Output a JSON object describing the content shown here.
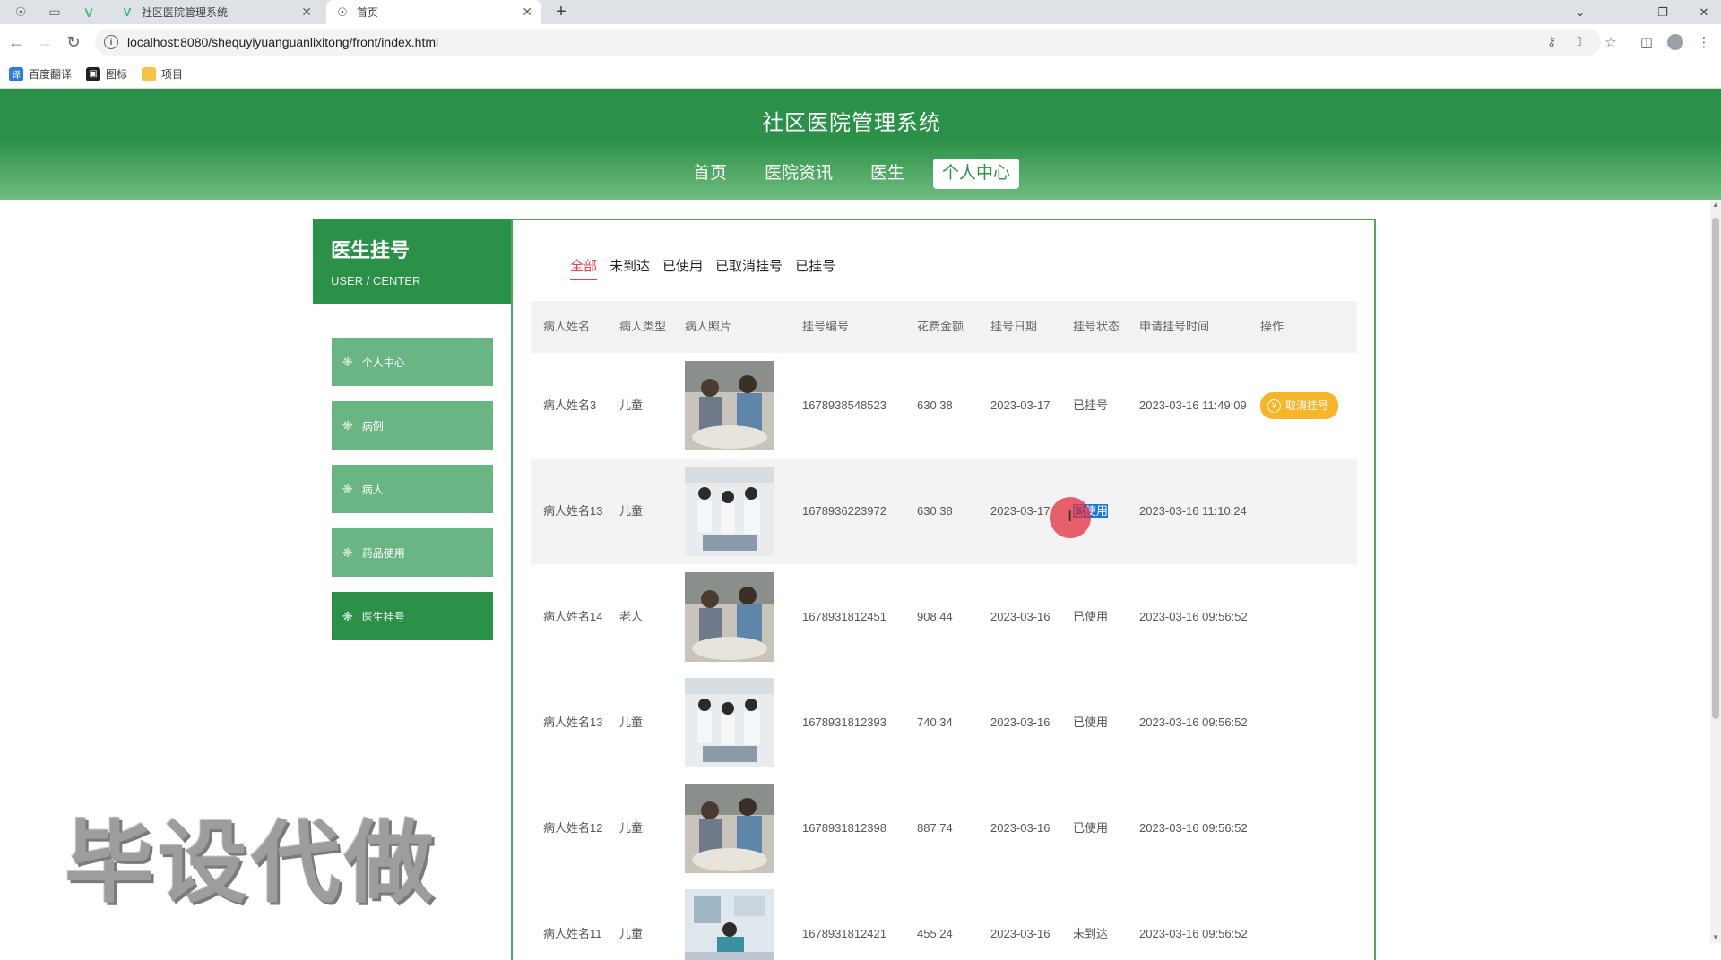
{
  "browser": {
    "tabs": [
      {
        "title": "社区医院管理系统",
        "active": false
      },
      {
        "title": "首页",
        "active": true
      }
    ],
    "url": "localhost:8080/shequyiyuanguanlixitong/front/index.html",
    "bookmarks": [
      {
        "label": "百度翻译",
        "icon": "translate-icon"
      },
      {
        "label": "图标",
        "icon": "image-icon"
      },
      {
        "label": "项目",
        "icon": "folder-icon"
      }
    ]
  },
  "header": {
    "title": "社区医院管理系统",
    "nav": [
      {
        "label": "首页",
        "active": false
      },
      {
        "label": "医院资讯",
        "active": false
      },
      {
        "label": "医生",
        "active": false
      },
      {
        "label": "个人中心",
        "active": true
      }
    ]
  },
  "sidebar": {
    "title": "医生挂号",
    "subtitle": "USER / CENTER",
    "items": [
      {
        "label": "个人中心",
        "active": false
      },
      {
        "label": "病例",
        "active": false
      },
      {
        "label": "病人",
        "active": false
      },
      {
        "label": "药品使用",
        "active": false
      },
      {
        "label": "医生挂号",
        "active": true
      }
    ]
  },
  "filters": [
    {
      "label": "全部",
      "active": true
    },
    {
      "label": "未到达",
      "active": false
    },
    {
      "label": "已使用",
      "active": false
    },
    {
      "label": "已取消挂号",
      "active": false
    },
    {
      "label": "已挂号",
      "active": false
    }
  ],
  "table": {
    "headers": {
      "name": "病人姓名",
      "type": "病人类型",
      "photo": "病人照片",
      "no": "挂号编号",
      "amount": "花费金额",
      "date": "挂号日期",
      "state": "挂号状态",
      "time": "申请挂号时间",
      "op": "操作"
    },
    "rows": [
      {
        "name": "病人姓名3",
        "type": "儿童",
        "photo": "photo-a",
        "no": "1678938548523",
        "amount": "630.38",
        "date": "2023-03-17",
        "state": "已挂号",
        "time": "2023-03-16 11:49:09",
        "action": "取消挂号"
      },
      {
        "name": "病人姓名13",
        "type": "儿童",
        "photo": "photo-b",
        "no": "1678936223972",
        "amount": "630.38",
        "date": "2023-03-17",
        "state": "已使用",
        "time": "2023-03-16 11:10:24",
        "action": ""
      },
      {
        "name": "病人姓名14",
        "type": "老人",
        "photo": "photo-a",
        "no": "1678931812451",
        "amount": "908.44",
        "date": "2023-03-16",
        "state": "已使用",
        "time": "2023-03-16 09:56:52",
        "action": ""
      },
      {
        "name": "病人姓名13",
        "type": "儿童",
        "photo": "photo-b",
        "no": "1678931812393",
        "amount": "740.34",
        "date": "2023-03-16",
        "state": "已使用",
        "time": "2023-03-16 09:56:52",
        "action": ""
      },
      {
        "name": "病人姓名12",
        "type": "儿童",
        "photo": "photo-a",
        "no": "1678931812398",
        "amount": "887.74",
        "date": "2023-03-16",
        "state": "已使用",
        "time": "2023-03-16 09:56:52",
        "action": ""
      },
      {
        "name": "病人姓名11",
        "type": "儿童",
        "photo": "photo-c",
        "no": "1678931812421",
        "amount": "455.24",
        "date": "2023-03-16",
        "state": "未到达",
        "time": "2023-03-16 09:56:52",
        "action": ""
      }
    ]
  },
  "watermark": "毕设代做",
  "colors": {
    "primary": "#2b9148",
    "sidebar_item": "#6ab584",
    "active_filter": "#e8434c",
    "cancel_button": "#f7b52a"
  }
}
